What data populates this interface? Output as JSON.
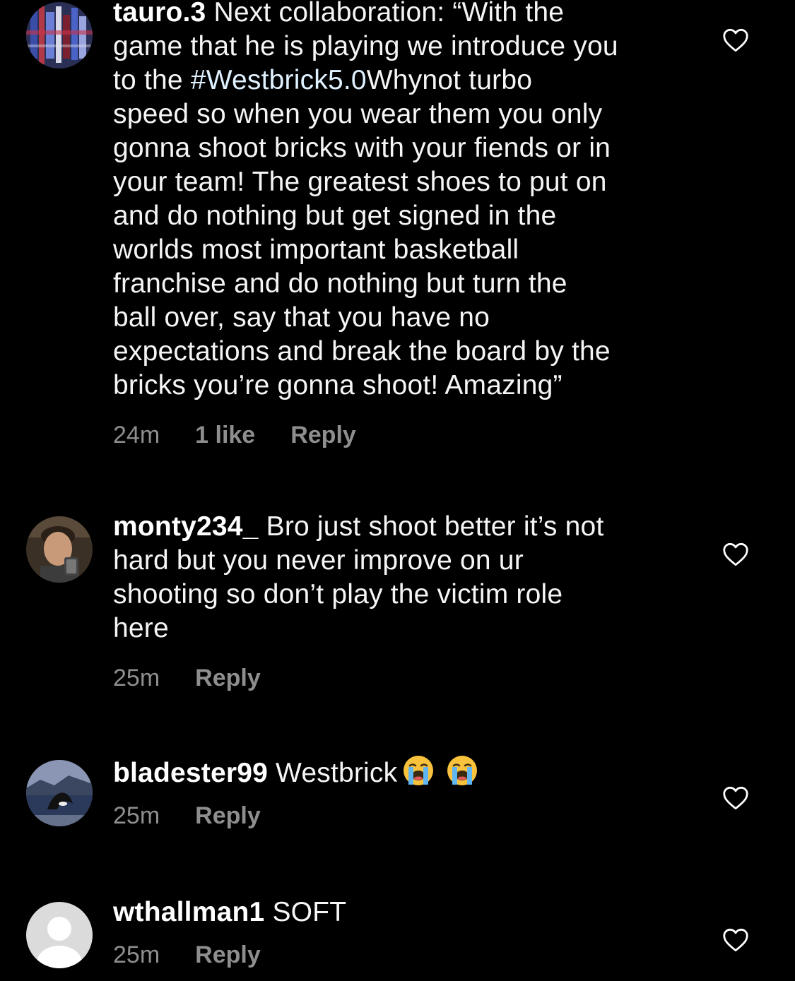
{
  "comments": [
    {
      "username": "tauro.3",
      "text_before": "Next collaboration: “With the\ngame that he is playing we introduce you\nto the ",
      "hashtag": "#Westbrick5.0",
      "text_after": "Whynot turbo\nspeed so when you wear them you only\ngonna shoot bricks with your fiends or in\nyour team! The greatest shoes to put on\nand do nothing but get signed in the\nworlds most important basketball\nfranchise and do nothing but turn the\nball over, say that you have no\nexpectations and break the board by the\nbricks you’re gonna shoot! Amazing”",
      "time": "24m",
      "likes": "1 like",
      "reply": "Reply"
    },
    {
      "username": "monty234_",
      "text": "Bro just shoot better it’s not\nhard but you never improve  on ur\nshooting so don’t play the victim role\nhere",
      "time": "25m",
      "reply": "Reply"
    },
    {
      "username": "bladester99",
      "text": "Westbrick",
      "emoji": [
        "loudly-crying-face-emoji",
        "loudly-crying-face-emoji"
      ],
      "time": "25m",
      "reply": "Reply"
    },
    {
      "username": "wthallman1",
      "text": "SOFT",
      "time": "25m",
      "reply": "Reply"
    }
  ],
  "colors": {
    "background": "#000000",
    "text": "#f5f5f5",
    "meta": "#8e8e8e",
    "hashtag": "#e0f1ff",
    "heart": "#ffffff",
    "default_avatar_bg": "#dbdbdb"
  },
  "icons": [
    "heart-outline-icon",
    "avatar-image",
    "default-avatar-icon"
  ]
}
